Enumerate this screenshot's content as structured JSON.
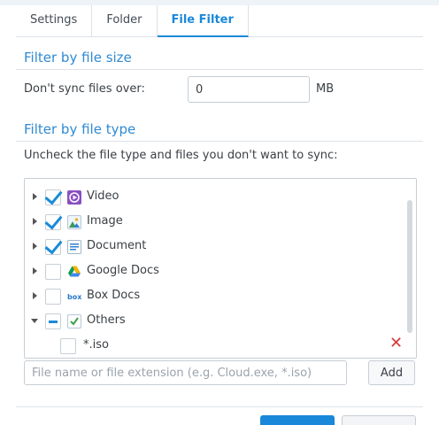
{
  "tabs": [
    {
      "label": "Settings",
      "active": false
    },
    {
      "label": "Folder",
      "active": false
    },
    {
      "label": "File Filter",
      "active": true
    }
  ],
  "size_section": {
    "title": "Filter by file size",
    "label": "Don't sync files over:",
    "value": "0",
    "unit": "MB"
  },
  "type_section": {
    "title": "Filter by file type",
    "instruction": "Uncheck the file type and files you don't want to sync:"
  },
  "tree": [
    {
      "label": "Video",
      "checked": "checked",
      "icon": "video-icon",
      "color": "#8a4fc2",
      "expanded": false
    },
    {
      "label": "Image",
      "checked": "checked",
      "icon": "image-icon",
      "color": "#3d9a4e",
      "expanded": false
    },
    {
      "label": "Document",
      "checked": "checked",
      "icon": "document-icon",
      "color": "#2f7fd0",
      "expanded": false
    },
    {
      "label": "Google Docs",
      "checked": "unchecked",
      "icon": "google-drive-icon",
      "color": "#f4b400",
      "expanded": false
    },
    {
      "label": "Box Docs",
      "checked": "unchecked",
      "icon": "box-icon",
      "color": "#2a79c9",
      "expanded": false
    },
    {
      "label": "Others",
      "checked": "partial",
      "icon": "others-check-icon",
      "color": "#3aa34a",
      "expanded": true
    },
    {
      "label": "*.iso",
      "checked": "unchecked",
      "child": true
    }
  ],
  "extension_input": {
    "placeholder": "File name or file extension (e.g. Cloud.exe, *.iso)",
    "value": ""
  },
  "add_label": "Add",
  "colors": {
    "accent": "#1a88d9",
    "delete": "#d43a3a"
  }
}
